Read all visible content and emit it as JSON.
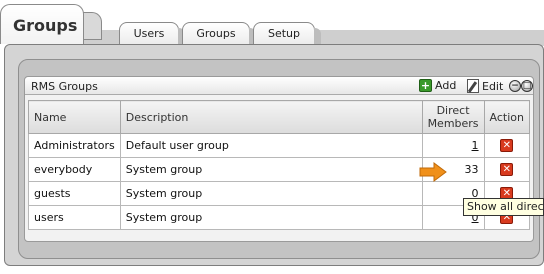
{
  "page": {
    "title": "Groups"
  },
  "tabs": [
    {
      "label": "Users"
    },
    {
      "label": "Groups"
    },
    {
      "label": "Setup"
    }
  ],
  "panel": {
    "title": "RMS Groups",
    "add_label": "Add",
    "edit_label": "Edit"
  },
  "table": {
    "headers": {
      "name": "Name",
      "description": "Description",
      "members_line1": "Direct",
      "members_line2": "Members",
      "action": "Action"
    },
    "rows": [
      {
        "name": "Administrators",
        "description": "Default user group",
        "members": "1"
      },
      {
        "name": "everybody",
        "description": "System group",
        "members": "33"
      },
      {
        "name": "guests",
        "description": "System group",
        "members": "0"
      },
      {
        "name": "users",
        "description": "System group",
        "members": "0"
      }
    ]
  },
  "tooltip": {
    "text": "Show all direct m"
  },
  "icons": {
    "add": "add-icon",
    "edit": "edit-icon",
    "delete": "delete-icon",
    "pointer": "arrow-pointer-icon"
  },
  "colors": {
    "delete": "#d83a1e",
    "add": "#3a9a2a",
    "pointer": "#f0901a",
    "tooltip_bg": "#ffffe1"
  }
}
